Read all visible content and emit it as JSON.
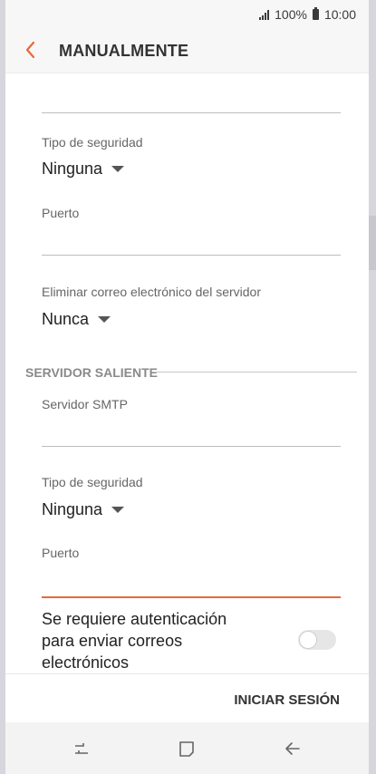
{
  "status": {
    "battery": "100%",
    "time": "10:00"
  },
  "header": {
    "title": "MANUALMENTE"
  },
  "incoming": {
    "security_label": "Tipo de seguridad",
    "security_value": "Ninguna",
    "port_label": "Puerto",
    "delete_label": "Eliminar correo electrónico del servidor",
    "delete_value": "Nunca"
  },
  "outgoing": {
    "section_title": "SERVIDOR SALIENTE",
    "smtp_label": "Servidor SMTP",
    "security_label": "Tipo de seguridad",
    "security_value": "Ninguna",
    "port_label": "Puerto",
    "auth_text": "Se requiere autenticación para enviar correos electrónicos",
    "auth_enabled": false
  },
  "actions": {
    "signin_label": "INICIAR SESIÓN"
  },
  "icons": {
    "back": "chevron-left-icon",
    "signal": "signal-icon",
    "battery": "battery-icon",
    "recent": "recent-apps-icon",
    "home": "home-icon",
    "nav_back": "back-arrow-icon"
  },
  "colors": {
    "accent": "#e8683a"
  }
}
